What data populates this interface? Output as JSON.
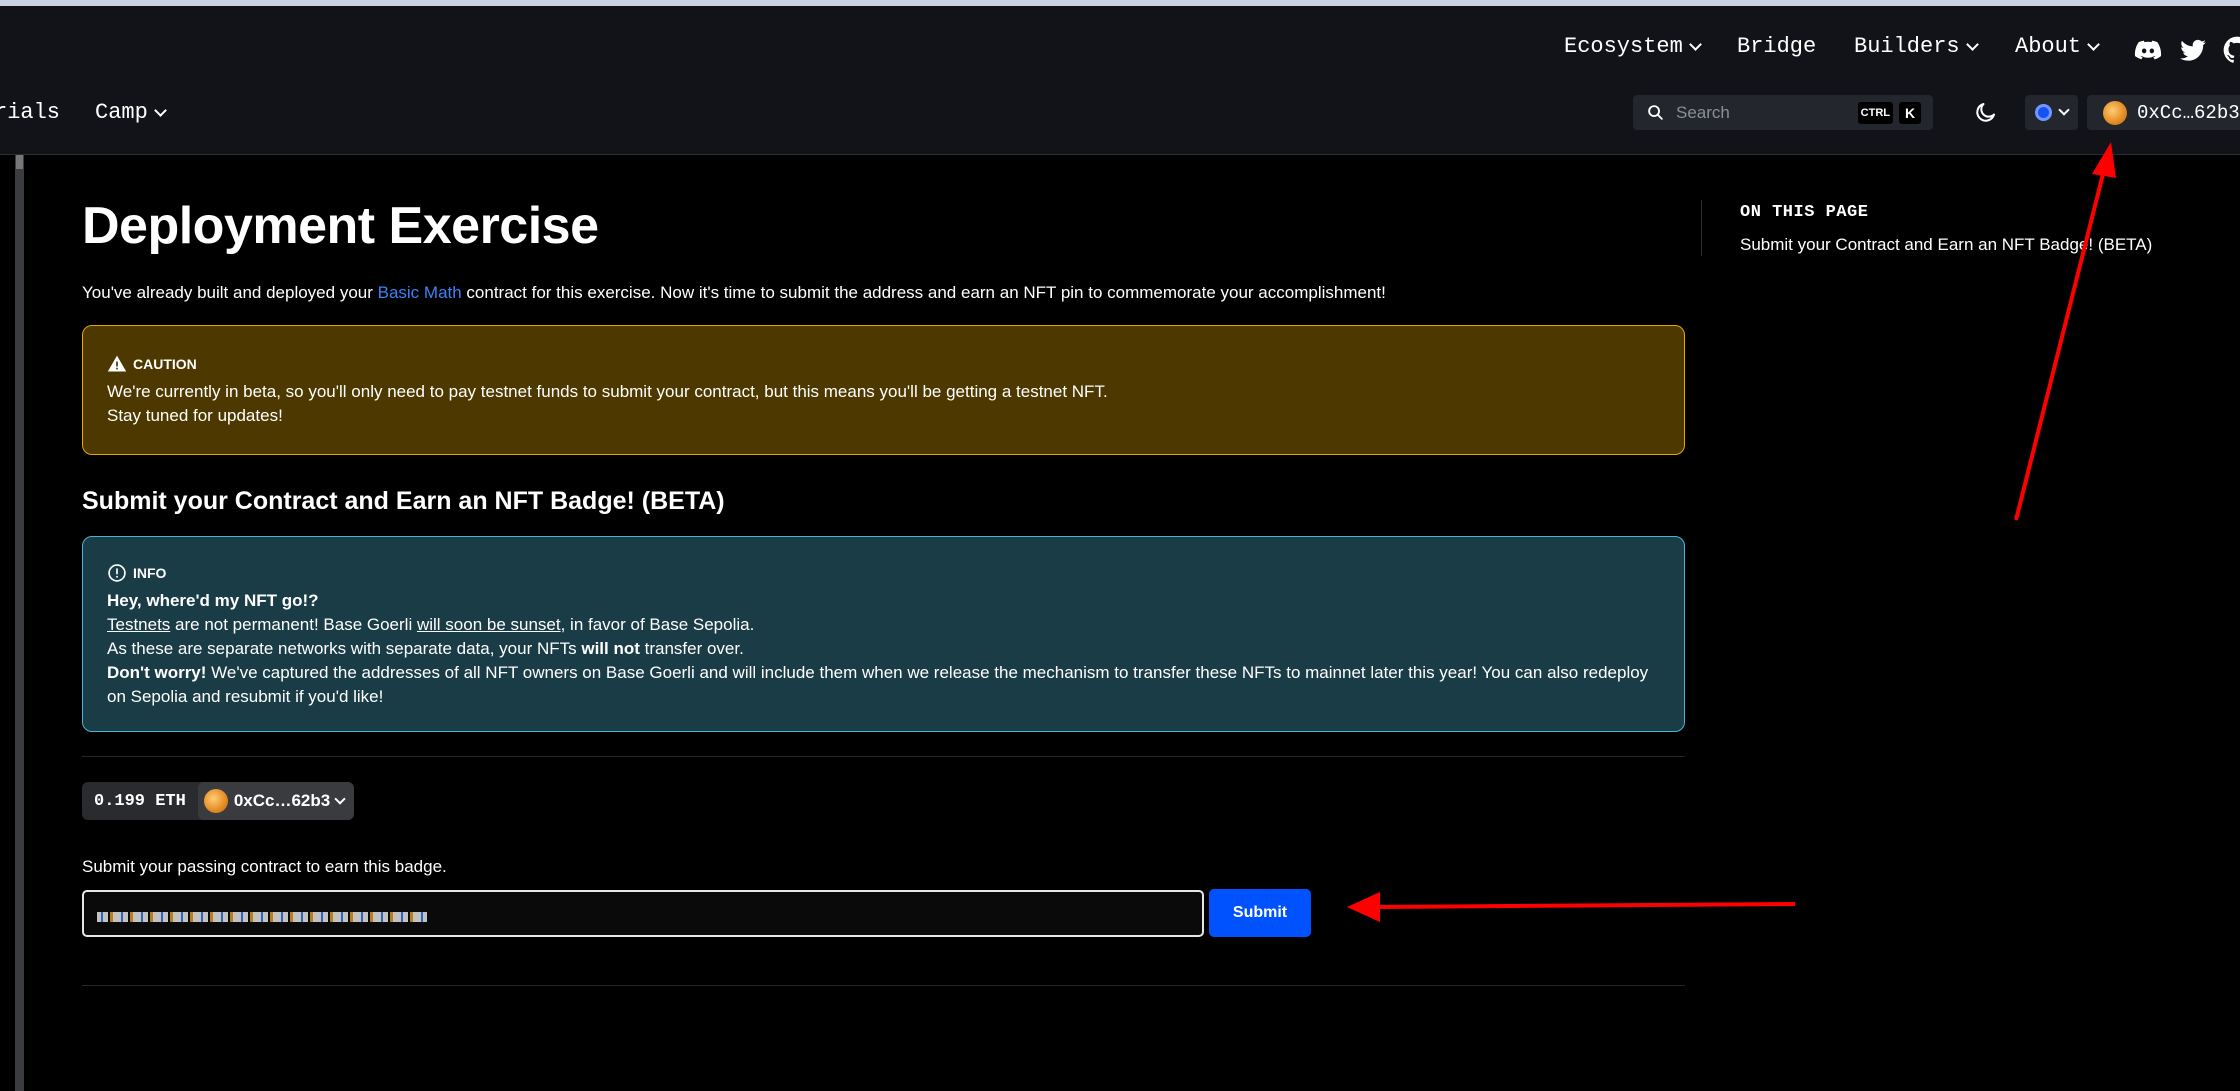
{
  "nav": {
    "top_links": [
      {
        "label": "Ecosystem"
      },
      {
        "label": "Bridge"
      },
      {
        "label": "Builders"
      },
      {
        "label": "About"
      }
    ],
    "sub_links": [
      {
        "label": "rials"
      },
      {
        "label": "Camp"
      }
    ],
    "search_placeholder": "Search",
    "search_kbd_ctrl": "CTRL",
    "search_kbd_k": "K",
    "account_address": "0xCc…62b3",
    "icons": [
      "discord-icon",
      "twitter-icon",
      "github-icon",
      "search-icon",
      "moon-icon",
      "network-icon"
    ]
  },
  "page": {
    "title": "Deployment Exercise",
    "intro_before": "You've already built and deployed your ",
    "intro_link": "Basic Math",
    "intro_after": " contract for this exercise. Now it's time to submit the address and earn an NFT pin to commemorate your accomplishment!",
    "caution": {
      "heading": "CAUTION",
      "line1": "We're currently in beta, so you'll only need to pay testnet funds to submit your contract, but this means you'll be getting a testnet NFT.",
      "line2": "Stay tuned for updates!"
    },
    "section_title": "Submit your Contract and Earn an NFT Badge! (BETA)",
    "info": {
      "heading": "INFO",
      "question": "Hey, where'd my NFT go!?",
      "p1_link": "Testnets",
      "p1_mid": " are not permanent! Base Goerli ",
      "p1_link2": "will soon be sunset",
      "p1_end": ", in favor of Base Sepolia.",
      "p2_start": "As these are separate networks with separate data, your NFTs ",
      "p2_bold": "will not",
      "p2_end": " transfer over.",
      "p3_bold": "Don't worry!",
      "p3_rest": " We've captured the addresses of all NFT owners on Base Goerli and will include them when we release the mechanism to transfer these NFTs to mainnet later this year! You can also redeploy on Sepolia and resubmit if you'd like!"
    },
    "balance": "0.199 ETH",
    "wallet_address": "0xCc…62b3",
    "submit_label": "Submit your passing contract to earn this badge.",
    "submit_button": "Submit"
  },
  "toc": {
    "title": "ON THIS PAGE",
    "items": [
      "Submit your Contract and Earn an NFT Badge! (BETA)"
    ]
  },
  "colors": {
    "caution_bg": "#4d3800",
    "caution_border": "#e6a700",
    "info_bg": "#193c47",
    "info_border": "#4cb3d4",
    "primary_button": "#0052ff",
    "link": "#3b82f6",
    "annotation_arrow": "#ff0000"
  }
}
